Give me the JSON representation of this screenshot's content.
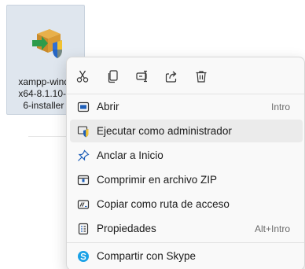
{
  "file": {
    "label_lines": [
      "xampp-windo",
      "x64-8.1.10-0-",
      "6-installer ("
    ],
    "icon": "xampp-installer-icon"
  },
  "context_menu": {
    "toolbar": [
      {
        "name": "cut-icon",
        "label": "Cortar"
      },
      {
        "name": "copy-icon",
        "label": "Copiar"
      },
      {
        "name": "rename-icon",
        "label": "Cambiar nombre"
      },
      {
        "name": "share-icon",
        "label": "Compartir"
      },
      {
        "name": "delete-icon",
        "label": "Eliminar"
      }
    ],
    "items": [
      {
        "label": "Abrir",
        "shortcut": "Intro",
        "icon": "open-window-icon"
      },
      {
        "label": "Ejecutar como administrador",
        "shortcut": "",
        "icon": "admin-shield-icon"
      },
      {
        "label": "Anclar a Inicio",
        "shortcut": "",
        "icon": "pin-icon"
      },
      {
        "label": "Comprimir en archivo ZIP",
        "shortcut": "",
        "icon": "zip-folder-icon"
      },
      {
        "label": "Copiar como ruta de acceso",
        "shortcut": "",
        "icon": "path-icon"
      },
      {
        "label": "Propiedades",
        "shortcut": "Alt+Intro",
        "icon": "properties-icon"
      },
      {
        "label": "Compartir con Skype",
        "shortcut": "",
        "icon": "skype-icon"
      }
    ]
  },
  "colors": {
    "accent": "#1f5fb8",
    "skype": "#1aa1e6",
    "menu_bg": "#f9f9f9",
    "hover_bg": "#ebebeb"
  }
}
